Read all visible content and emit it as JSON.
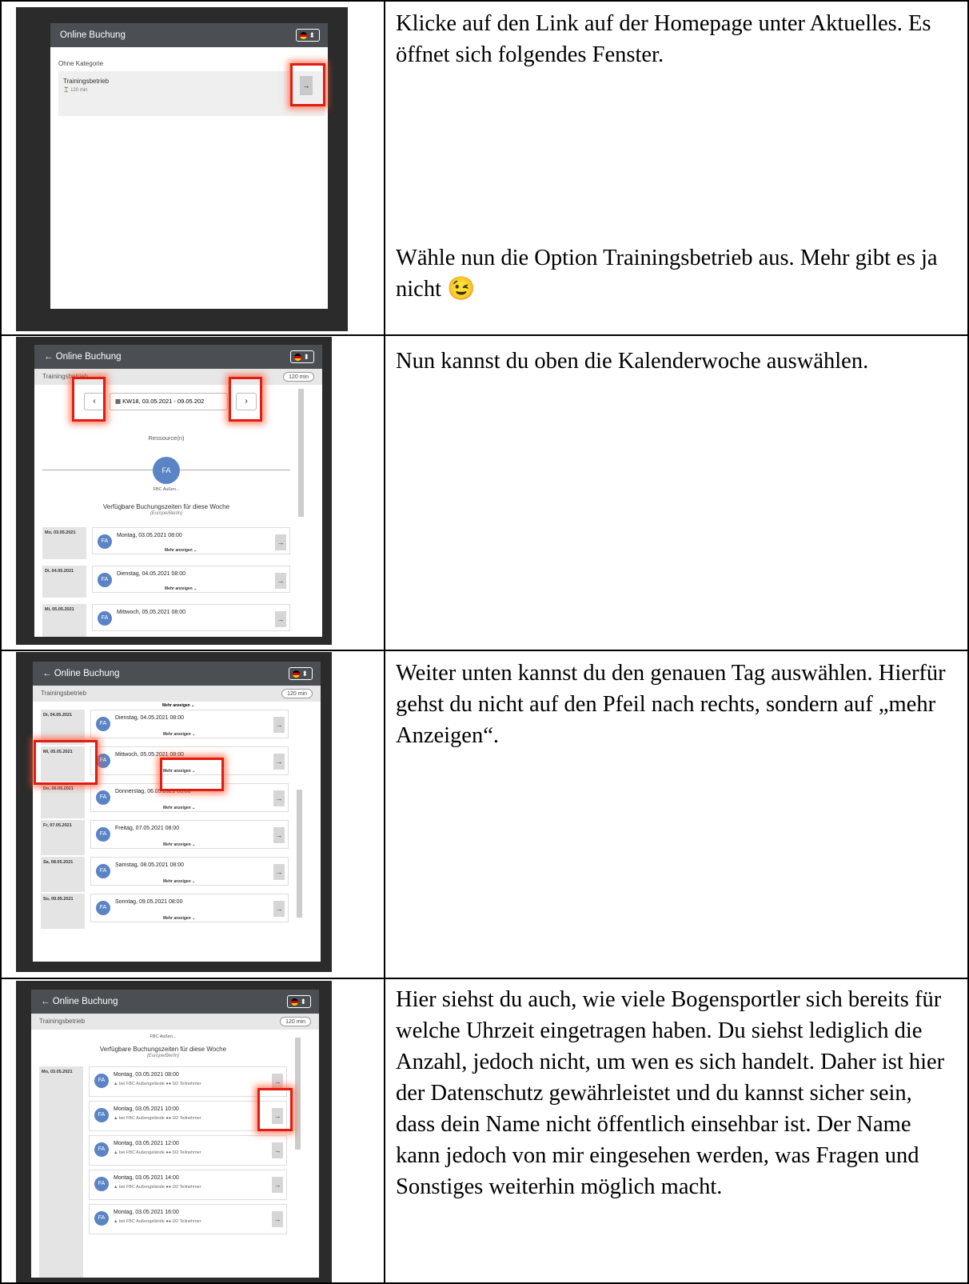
{
  "rows": [
    {
      "text": [
        "Klicke auf den Link auf der Homepage unter Aktuelles. Es öffnet sich folgendes Fenster.",
        "Wähle nun die Option Trainingsbetrieb aus. Mehr gibt es ja nicht 😉"
      ]
    },
    {
      "text": [
        "Nun kannst du oben die Kalenderwoche auswählen."
      ]
    },
    {
      "text": [
        "Weiter unten kannst du den genauen Tag auswählen. Hierfür gehst du nicht auf den Pfeil nach rechts, sondern auf „mehr Anzeigen“."
      ]
    },
    {
      "text": [
        "Hier siehst du auch, wie viele Bogensportler sich bereits für welche Uhrzeit eingetragen haben. Du siehst lediglich die Anzahl, jedoch nicht, um wen es sich handelt. Daher ist hier der Datenschutz gewährleistet und du kannst sicher sein, dass dein Name nicht öffentlich einsehbar ist. Der Name kann jedoch von mir eingesehen werden, was Fragen und Sonstiges weiterhin möglich macht."
      ]
    }
  ],
  "ui": {
    "title": "Online Buchung",
    "title_back": "← Online Buchung",
    "no_category": "Ohne Kategorie",
    "service": "Trainingsbetrieb",
    "duration": "⌛ 120 min",
    "duration_pill": "120 min",
    "week": "KW18, 03.05.2021 - 09.05.202",
    "resources": "Ressource(n)",
    "resource_short": "FBC Außen...",
    "avatar": "FA",
    "available": "Verfügbare Buchungszeiten für diese Woche",
    "timezone": "(Europe/Berlin)",
    "more": "Mehr anzeigen ⌄",
    "location": "bei FBC Außengelände",
    "participants": "0/2 Teilnehmer",
    "arrow": "→"
  },
  "shot2": {
    "days": [
      "Mo, 03.05.2021",
      "Di, 04.05.2021",
      "Mi, 05.05.2021"
    ],
    "slots": [
      "Montag, 03.05.2021 08:00",
      "Dienstag, 04.05.2021 08:00",
      "Mittwoch, 05.05.2021 08:00"
    ]
  },
  "shot3": {
    "days": [
      "Di, 04.05.2021",
      "Mi, 05.05.2021",
      "Do, 06.05.2021",
      "Fr, 07.05.2021",
      "Sa, 08.05.2021",
      "So, 09.05.2021"
    ],
    "slots": [
      "Dienstag, 04.05.2021 08:00",
      "Mittwoch, 05.05.2021 08:00",
      "Donnerstag, 06.05.2021 08:00",
      "Freitag, 07.05.2021 08:00",
      "Samstag, 08.05.2021 08:00",
      "Sonntag, 09.05.2021 08:00"
    ]
  },
  "shot4": {
    "day": "Mo, 03.05.2021",
    "slots": [
      "Montag, 03.05.2021 08:00",
      "Montag, 03.05.2021 10:00",
      "Montag, 03.05.2021 12:00",
      "Montag, 03.05.2021 14:00",
      "Montag, 03.05.2021 16:00"
    ]
  }
}
